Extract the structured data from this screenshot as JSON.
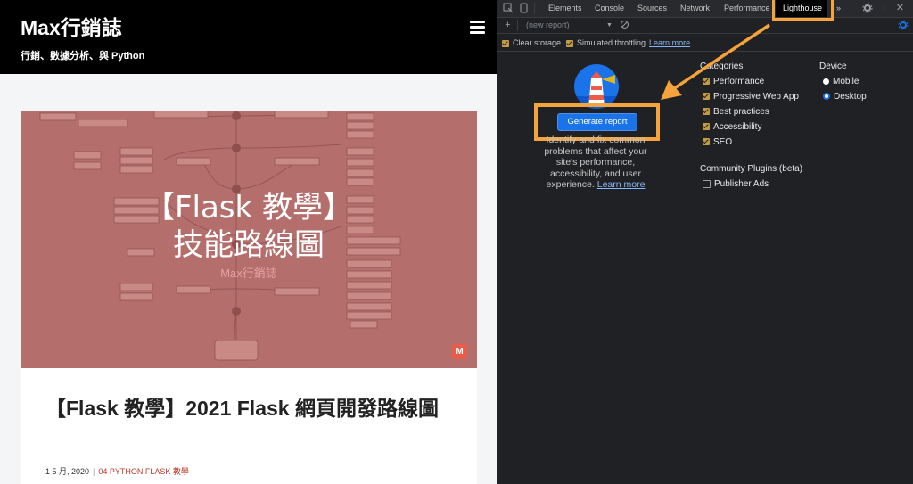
{
  "site": {
    "title": "Max行銷誌",
    "tagline": "行銷、數據分析、與 Python",
    "thumbnail": {
      "title_line1": "【Flask 教學】",
      "title_line2": "技能路線圖",
      "brand": "Max行銷誌",
      "badge": "M"
    },
    "post": {
      "title": "【Flask 教學】2021 Flask 網頁開發路線圖",
      "date": "1 5 月, 2020",
      "category": "04 PYTHON FLASK 教學"
    }
  },
  "devtools": {
    "tabs": [
      "Elements",
      "Console",
      "Sources",
      "Network",
      "Performance",
      "Lighthouse"
    ],
    "more_tabs": "»",
    "report_select": "(new report)",
    "clear_storage": "Clear storage",
    "simulated_throttling": "Simulated throttling",
    "learn_more_top": "Learn more",
    "generate_button": "Generate report",
    "description": "Identify and fix common problems that affect your site's performance, accessibility, and user experience.",
    "learn_more": "Learn more",
    "categories_title": "Categories",
    "categories": [
      {
        "label": "Performance",
        "checked": true
      },
      {
        "label": "Progressive Web App",
        "checked": true
      },
      {
        "label": "Best practices",
        "checked": true
      },
      {
        "label": "Accessibility",
        "checked": true
      },
      {
        "label": "SEO",
        "checked": true
      }
    ],
    "community_title": "Community Plugins (beta)",
    "plugins": [
      {
        "label": "Publisher Ads",
        "checked": false
      }
    ],
    "device_title": "Device",
    "devices": [
      {
        "label": "Mobile",
        "selected": false
      },
      {
        "label": "Desktop",
        "selected": true
      }
    ],
    "highlight_color": "#f5a33c",
    "accent": "#1a73e8"
  }
}
